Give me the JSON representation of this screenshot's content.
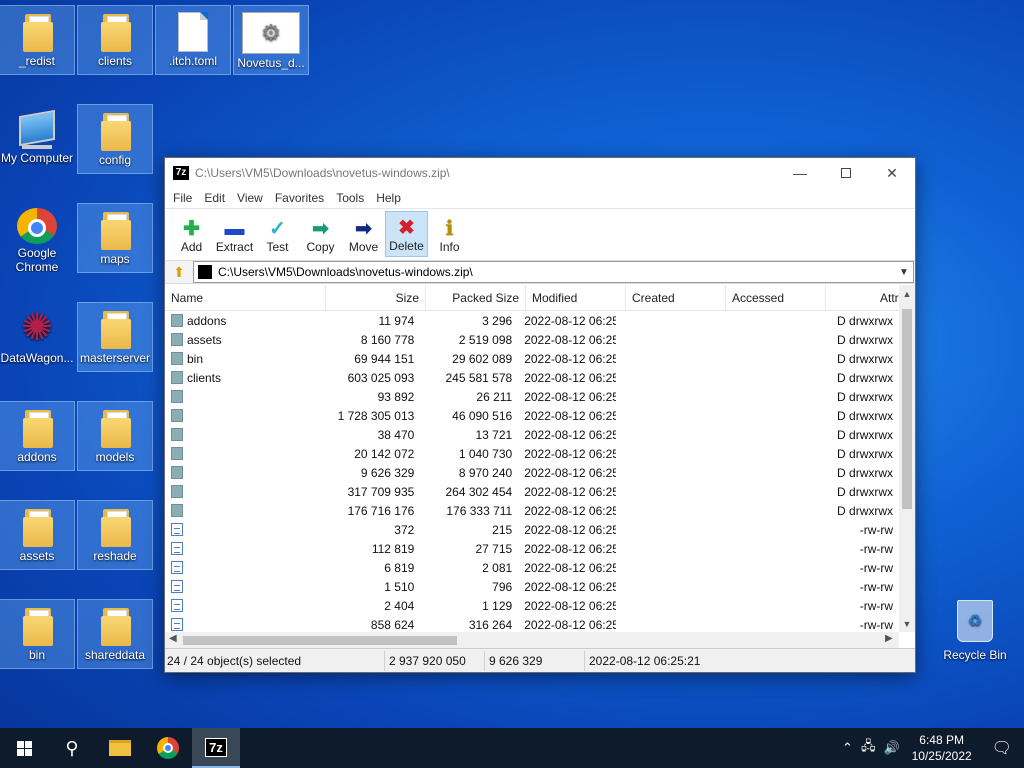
{
  "desktop": {
    "icons": [
      {
        "label": "_redist",
        "type": "folder"
      },
      {
        "label": "clients",
        "type": "folder"
      },
      {
        "label": ".itch.toml",
        "type": "doc"
      },
      {
        "label": "Novetus_d...",
        "type": "cfg"
      },
      {
        "label": "My Computer",
        "type": "computer"
      },
      {
        "label": "config",
        "type": "folder"
      },
      {
        "label": "Google Chrome",
        "type": "chrome"
      },
      {
        "label": "maps",
        "type": "folder"
      },
      {
        "label": "DataWagon...",
        "type": "datawagon"
      },
      {
        "label": "masterserver",
        "type": "folder"
      },
      {
        "label": "addons",
        "type": "folder"
      },
      {
        "label": "models",
        "type": "folder"
      },
      {
        "label": "assets",
        "type": "folder"
      },
      {
        "label": "reshade",
        "type": "folder"
      },
      {
        "label": "bin",
        "type": "folder"
      },
      {
        "label": "shareddata",
        "type": "folder"
      }
    ],
    "recycle_bin": "Recycle Bin"
  },
  "window": {
    "title": "C:\\Users\\VM5\\Downloads\\novetus-windows.zip\\",
    "app_icon": "7z",
    "menu": [
      "File",
      "Edit",
      "View",
      "Favorites",
      "Tools",
      "Help"
    ],
    "toolbar": [
      {
        "label": "Add",
        "icon": "plus-icon",
        "glyph": "✚",
        "color": "#21b14b"
      },
      {
        "label": "Extract",
        "icon": "minus-icon",
        "glyph": "▬",
        "color": "#2147c9"
      },
      {
        "label": "Test",
        "icon": "check-icon",
        "glyph": "✓",
        "color": "#24b5c6"
      },
      {
        "label": "Copy",
        "icon": "copy-arrow-icon",
        "glyph": "➡",
        "color": "#179a77"
      },
      {
        "label": "Move",
        "icon": "move-arrow-icon",
        "glyph": "➡",
        "color": "#13297f"
      },
      {
        "label": "Delete",
        "icon": "delete-x-icon",
        "glyph": "✖",
        "color": "#d4212a"
      },
      {
        "label": "Info",
        "icon": "info-icon",
        "glyph": "ℹ",
        "color": "#b3920a"
      }
    ],
    "address": "C:\\Users\\VM5\\Downloads\\novetus-windows.zip\\",
    "columns": [
      "Name",
      "Size",
      "Packed Size",
      "Modified",
      "Created",
      "Accessed",
      "Attrib"
    ],
    "rows": [
      {
        "name": "addons",
        "type": "folder",
        "size": "11 974",
        "packed": "3 296",
        "modified": "2022-08-12 06:25",
        "created": "",
        "accessed": "",
        "attrib": "D drwxrwx"
      },
      {
        "name": "assets",
        "type": "folder",
        "size": "8 160 778",
        "packed": "2 519 098",
        "modified": "2022-08-12 06:25",
        "created": "",
        "accessed": "",
        "attrib": "D drwxrwx"
      },
      {
        "name": "bin",
        "type": "folder",
        "size": "69 944 151",
        "packed": "29 602 089",
        "modified": "2022-08-12 06:25",
        "created": "",
        "accessed": "",
        "attrib": "D drwxrwx"
      },
      {
        "name": "clients",
        "type": "folder",
        "size": "603 025 093",
        "packed": "245 581 578",
        "modified": "2022-08-12 06:25",
        "created": "",
        "accessed": "",
        "attrib": "D drwxrwx"
      },
      {
        "name": "",
        "type": "folder",
        "size": "93 892",
        "packed": "26 211",
        "modified": "2022-08-12 06:25",
        "created": "",
        "accessed": "",
        "attrib": "D drwxrwx"
      },
      {
        "name": "",
        "type": "folder",
        "size": "1 728 305 013",
        "packed": "46 090 516",
        "modified": "2022-08-12 06:25",
        "created": "",
        "accessed": "",
        "attrib": "D drwxrwx"
      },
      {
        "name": "",
        "type": "folder",
        "size": "38 470",
        "packed": "13 721",
        "modified": "2022-08-12 06:25",
        "created": "",
        "accessed": "",
        "attrib": "D drwxrwx"
      },
      {
        "name": "",
        "type": "folder",
        "size": "20 142 072",
        "packed": "1 040 730",
        "modified": "2022-08-12 06:25",
        "created": "",
        "accessed": "",
        "attrib": "D drwxrwx"
      },
      {
        "name": "",
        "type": "folder",
        "size": "9 626 329",
        "packed": "8 970 240",
        "modified": "2022-08-12 06:25",
        "created": "",
        "accessed": "",
        "attrib": "D drwxrwx"
      },
      {
        "name": "",
        "type": "folder",
        "size": "317 709 935",
        "packed": "264 302 454",
        "modified": "2022-08-12 06:25",
        "created": "",
        "accessed": "",
        "attrib": "D drwxrwx"
      },
      {
        "name": "",
        "type": "folder",
        "size": "176 716 176",
        "packed": "176 333 711",
        "modified": "2022-08-12 06:25",
        "created": "",
        "accessed": "",
        "attrib": "D drwxrwx"
      },
      {
        "name": "",
        "type": "file",
        "size": "372",
        "packed": "215",
        "modified": "2022-08-12 06:25",
        "created": "",
        "accessed": "",
        "attrib": "-rw-rw"
      },
      {
        "name": "",
        "type": "file",
        "size": "112 819",
        "packed": "27 715",
        "modified": "2022-08-12 06:25",
        "created": "",
        "accessed": "",
        "attrib": "-rw-rw"
      },
      {
        "name": "",
        "type": "file",
        "size": "6 819",
        "packed": "2 081",
        "modified": "2022-08-12 06:25",
        "created": "",
        "accessed": "",
        "attrib": "-rw-rw"
      },
      {
        "name": "",
        "type": "file",
        "size": "1 510",
        "packed": "796",
        "modified": "2022-08-12 06:25",
        "created": "",
        "accessed": "",
        "attrib": "-rw-rw"
      },
      {
        "name": "",
        "type": "file",
        "size": "2 404",
        "packed": "1 129",
        "modified": "2022-08-12 06:25",
        "created": "",
        "accessed": "",
        "attrib": "-rw-rw"
      },
      {
        "name": "",
        "type": "file",
        "size": "858 624",
        "packed": "316 264",
        "modified": "2022-08-12 06:25",
        "created": "",
        "accessed": "",
        "attrib": "-rw-rw"
      }
    ],
    "status": {
      "selected": "24 / 24 object(s) selected",
      "total_size": "2 937 920 050",
      "packed": "9 626 329",
      "modified": "2022-08-12 06:25:21"
    }
  },
  "taskbar": {
    "clock_time": "6:48 PM",
    "clock_date": "10/25/2022"
  }
}
